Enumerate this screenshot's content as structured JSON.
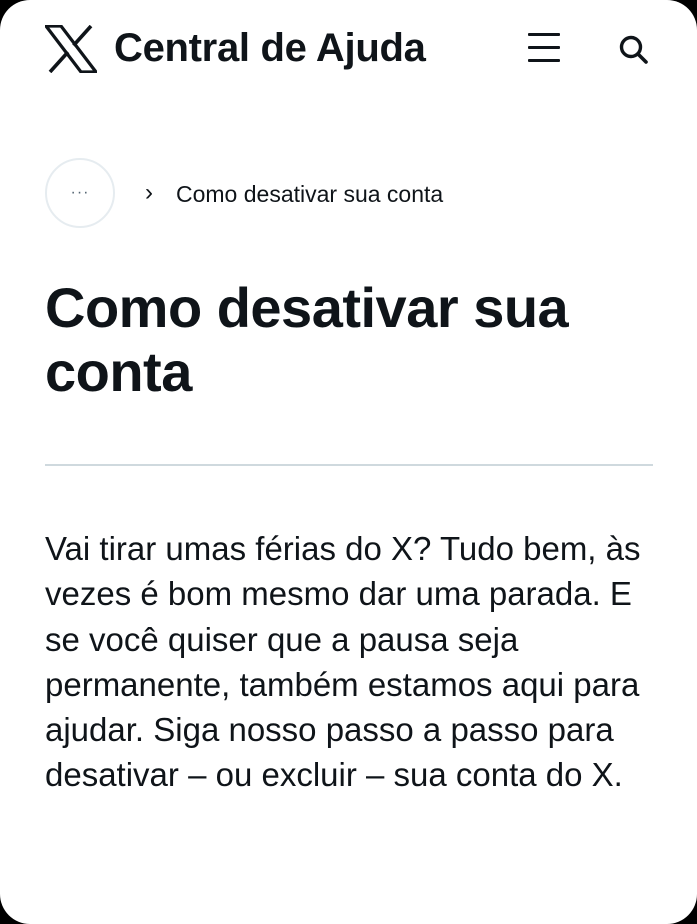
{
  "header": {
    "logo_icon": "x-logo-icon",
    "title": "Central de Ajuda",
    "menu_icon": "hamburger-menu-icon",
    "search_icon": "search-icon"
  },
  "breadcrumb": {
    "more_label": "···",
    "separator": "›",
    "current": "Como desativar sua conta"
  },
  "article": {
    "title": "Como desativar sua conta",
    "intro": "Vai tirar umas férias do X? Tudo bem, às vezes é bom mesmo dar uma parada. E se você quiser que a pausa seja permanente, também estamos aqui para ajudar. Siga nosso passo a passo para desativar – ou excluir – sua conta do X."
  },
  "colors": {
    "text": "#0f1419",
    "divider": "#cfd9de",
    "background": "#ffffff"
  }
}
